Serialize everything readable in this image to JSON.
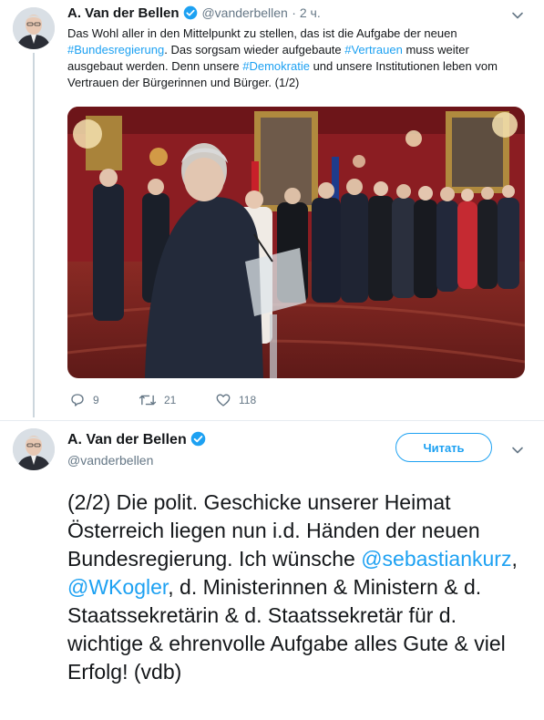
{
  "tweet1": {
    "author_name": "A. Van der Bellen",
    "handle": "@vanderbellen",
    "time": "· 2 ч.",
    "text_parts": [
      "Das Wohl aller in den Mittelpunkt zu stellen, das ist die Aufgabe der neuen ",
      "#Bundesregierung",
      ". Das sorgsam wieder aufgebaute ",
      "#Vertrauen",
      " muss weiter ausgebaut werden. Denn unsere ",
      "#Demokratie",
      " und unsere Institutionen leben vom Vertrauen der Bürgerinnen und Bürger. (1/2)"
    ],
    "replies": "9",
    "retweets": "21",
    "likes": "118"
  },
  "tweet2": {
    "author_name": "A. Van der Bellen",
    "handle": "@vanderbellen",
    "follow_label": "Читать",
    "text_parts": [
      "(2/2) Die polit. Geschicke unserer Heimat Österreich liegen nun i.d. Händen der neuen Bundesregierung. Ich wünsche ",
      "@sebastiankurz",
      ", ",
      "@WKogler",
      ", d. Ministerinnen & Ministern & d. Staatssekretärin & d. Staatssekretär für d. wichtige & ehrenvolle Aufgabe alles Gute & viel Erfolg! (vdb)"
    ]
  },
  "colors": {
    "link": "#1da1f2",
    "muted": "#657786",
    "verified": "#1da1f2",
    "photo_wall": "#8b1d22"
  },
  "icons": [
    "verified-badge-icon",
    "chevron-down-icon",
    "reply-icon",
    "retweet-icon",
    "like-icon"
  ]
}
